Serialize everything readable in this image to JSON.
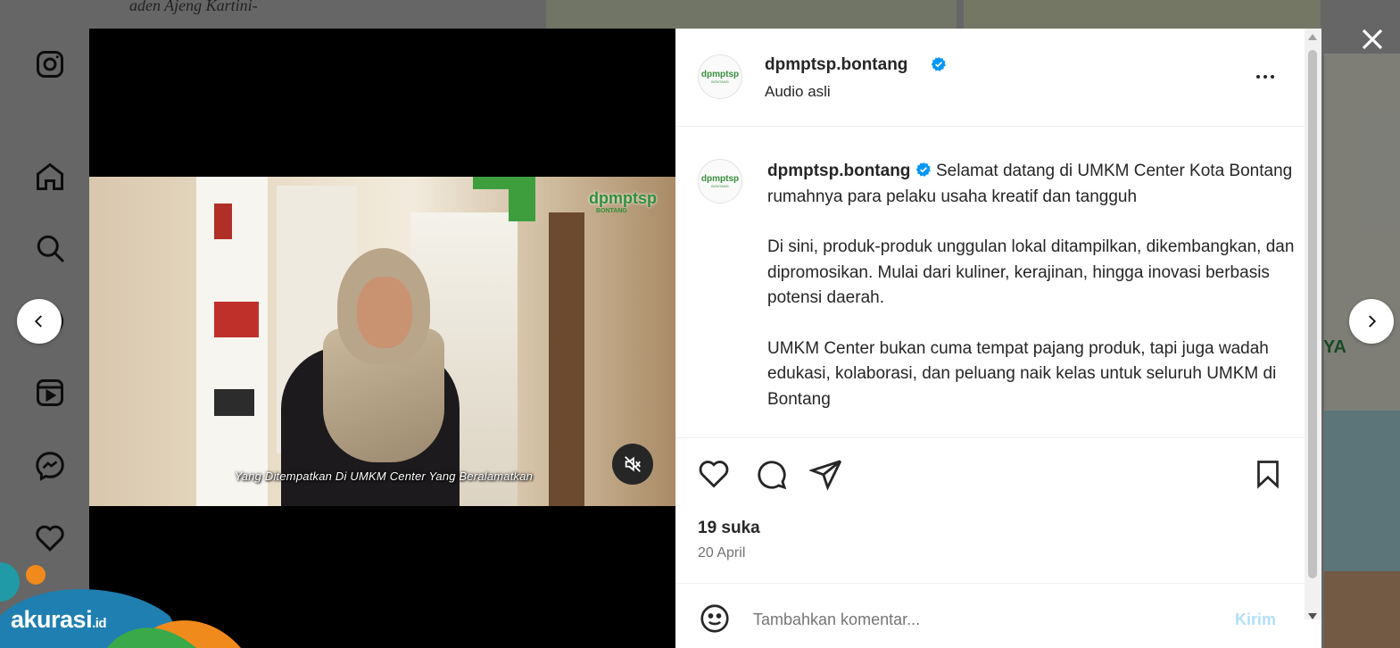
{
  "background": {
    "top_text": "aden Ajeng Kartini-",
    "right_text": "YA"
  },
  "sidebar": {
    "items": [
      {
        "icon": "instagram-icon"
      },
      {
        "icon": "home-icon"
      },
      {
        "icon": "search-icon"
      },
      {
        "icon": "explore-icon"
      },
      {
        "icon": "reels-icon"
      },
      {
        "icon": "messenger-icon"
      },
      {
        "icon": "heart-icon"
      }
    ]
  },
  "modal": {
    "header": {
      "username": "dpmptsp.bontang",
      "subtitle": "Audio asli",
      "avatar_text": "dpmptsp",
      "avatar_sub": "BONTANG"
    },
    "video": {
      "caption": "Yang Ditempatkan Di UMKM Center Yang Beralamatkan",
      "logo": "dpmptsp",
      "logo_sub": "BONTANG"
    },
    "caption": {
      "username": "dpmptsp.bontang",
      "paragraphs": [
        "Selamat datang di UMKM Center Kota Bontang rumahnya para pelaku usaha kreatif dan tangguh",
        "Di sini, produk-produk unggulan lokal ditampilkan, dikembangkan, dan dipromosikan. Mulai dari kuliner, kerajinan, hingga inovasi berbasis potensi daerah.",
        "UMKM Center bukan cuma tempat pajang produk, tapi juga wadah edukasi, kolaborasi, dan peluang naik kelas untuk seluruh UMKM di Bontang"
      ]
    },
    "stats": {
      "likes": "19 suka",
      "date": "20 April"
    },
    "comment": {
      "placeholder": "Tambahkan komentar...",
      "post_label": "Kirim"
    }
  },
  "brand": {
    "name": "akurasi",
    "suffix": ".id"
  },
  "colors": {
    "verified": "#0095f6",
    "brand_green": "#3a8e3e",
    "post_button": "#b2dffc"
  }
}
